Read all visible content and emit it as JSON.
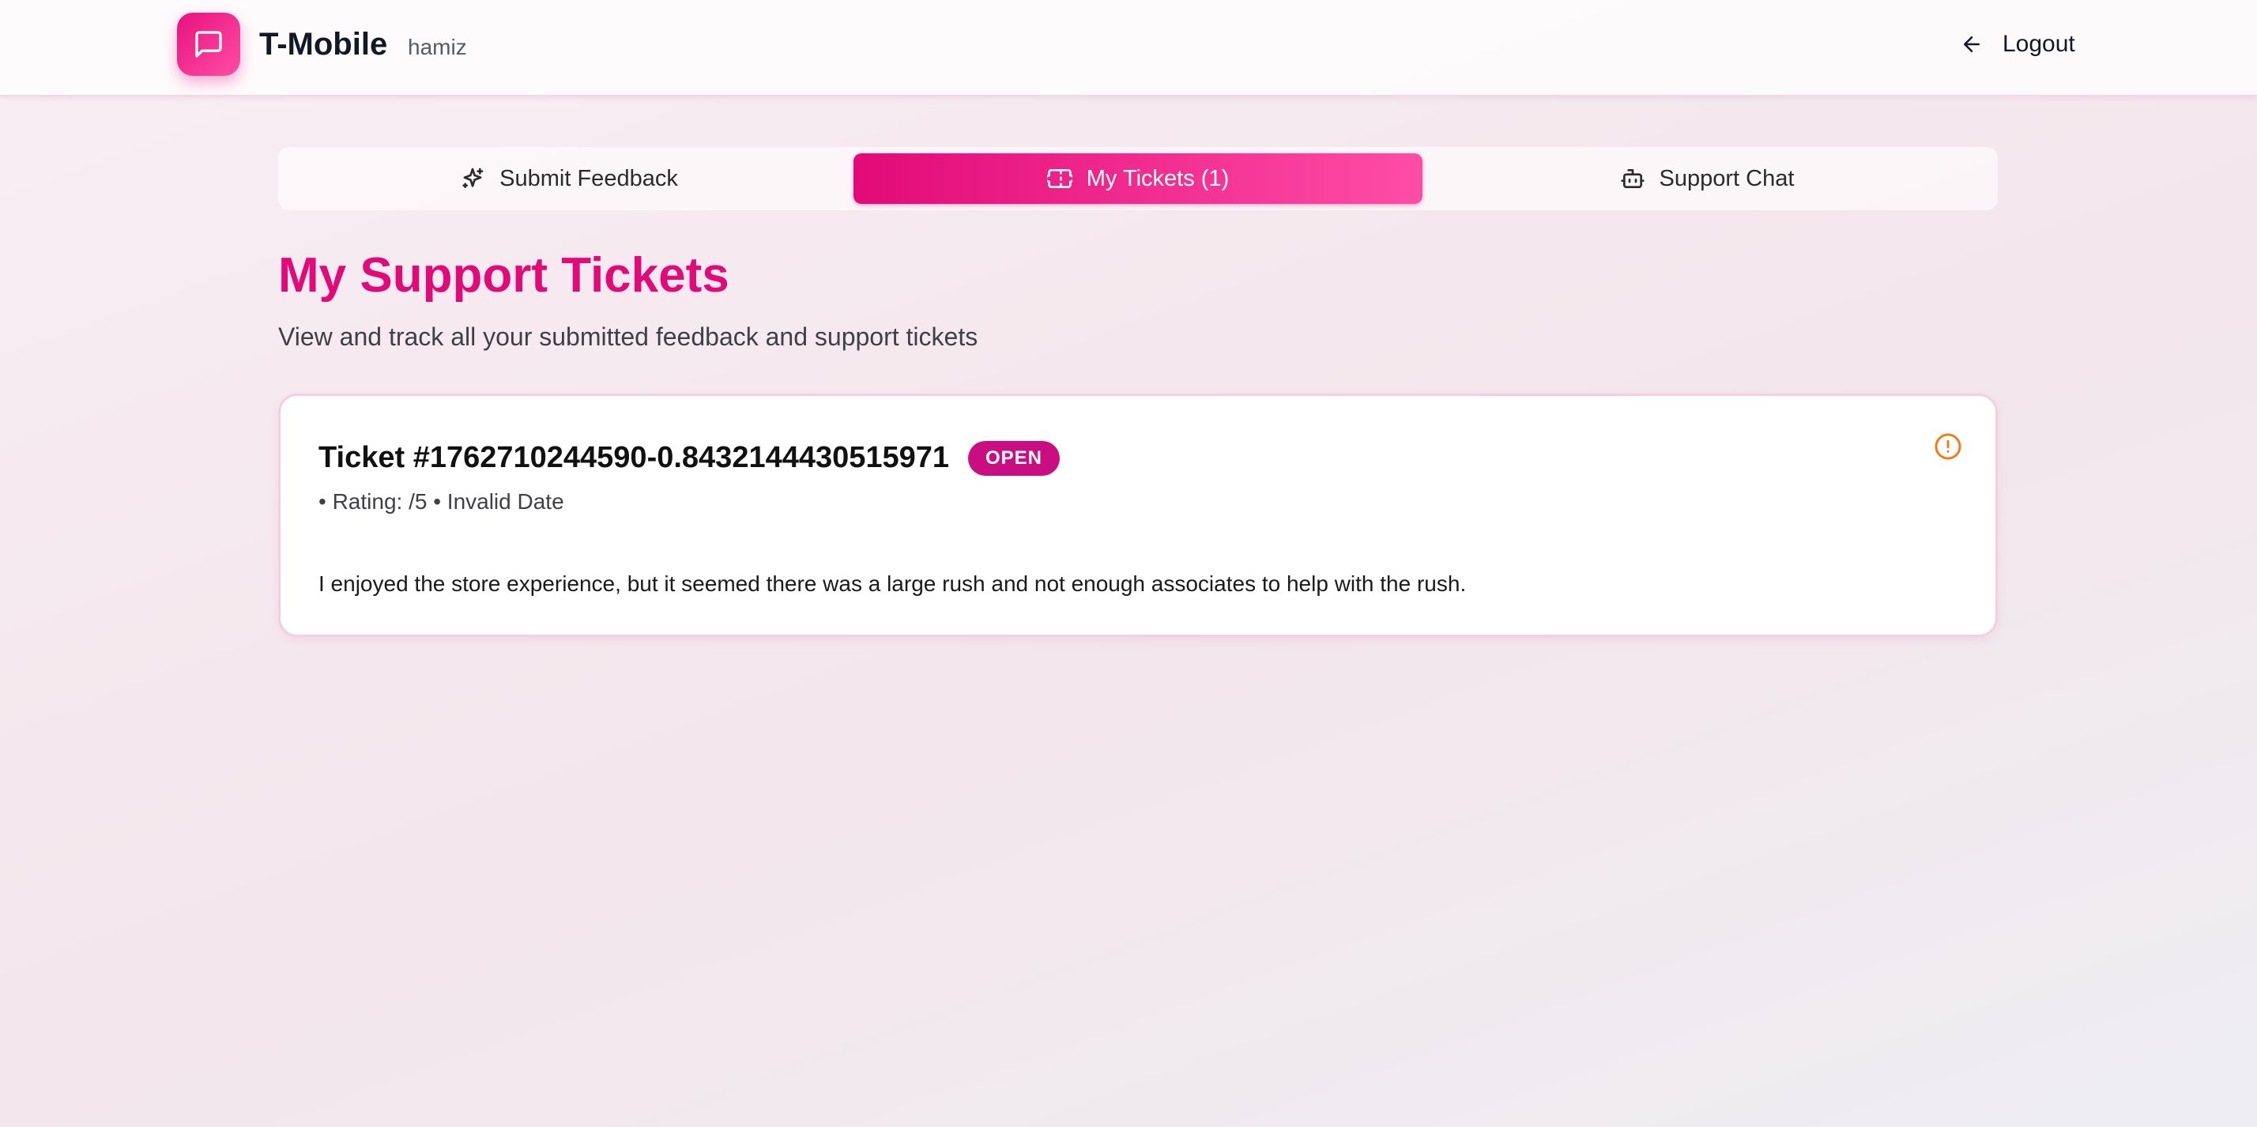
{
  "header": {
    "brand": "T-Mobile",
    "username": "hamiz",
    "logout_label": "Logout",
    "logo_icon": "message-square-icon"
  },
  "tabs": [
    {
      "label": "Submit Feedback",
      "icon": "sparkles-icon",
      "active": false
    },
    {
      "label": "My Tickets (1)",
      "icon": "ticket-icon",
      "active": true
    },
    {
      "label": "Support Chat",
      "icon": "bot-icon",
      "active": false
    }
  ],
  "page": {
    "title": "My Support Tickets",
    "subtitle": "View and track all your submitted feedback and support tickets"
  },
  "tickets": [
    {
      "title": "Ticket #1762710244590-0.8432144430515971",
      "status": "OPEN",
      "meta": "• Rating: /5 • Invalid Date",
      "message": "I enjoyed the store experience, but it seemed there was a large rush and not enough associates to help with the rush.",
      "status_icon": "alert-circle-icon"
    }
  ],
  "colors": {
    "accent": "#e20a78",
    "badge": "#c80e80",
    "alert": "#f07d1a"
  }
}
